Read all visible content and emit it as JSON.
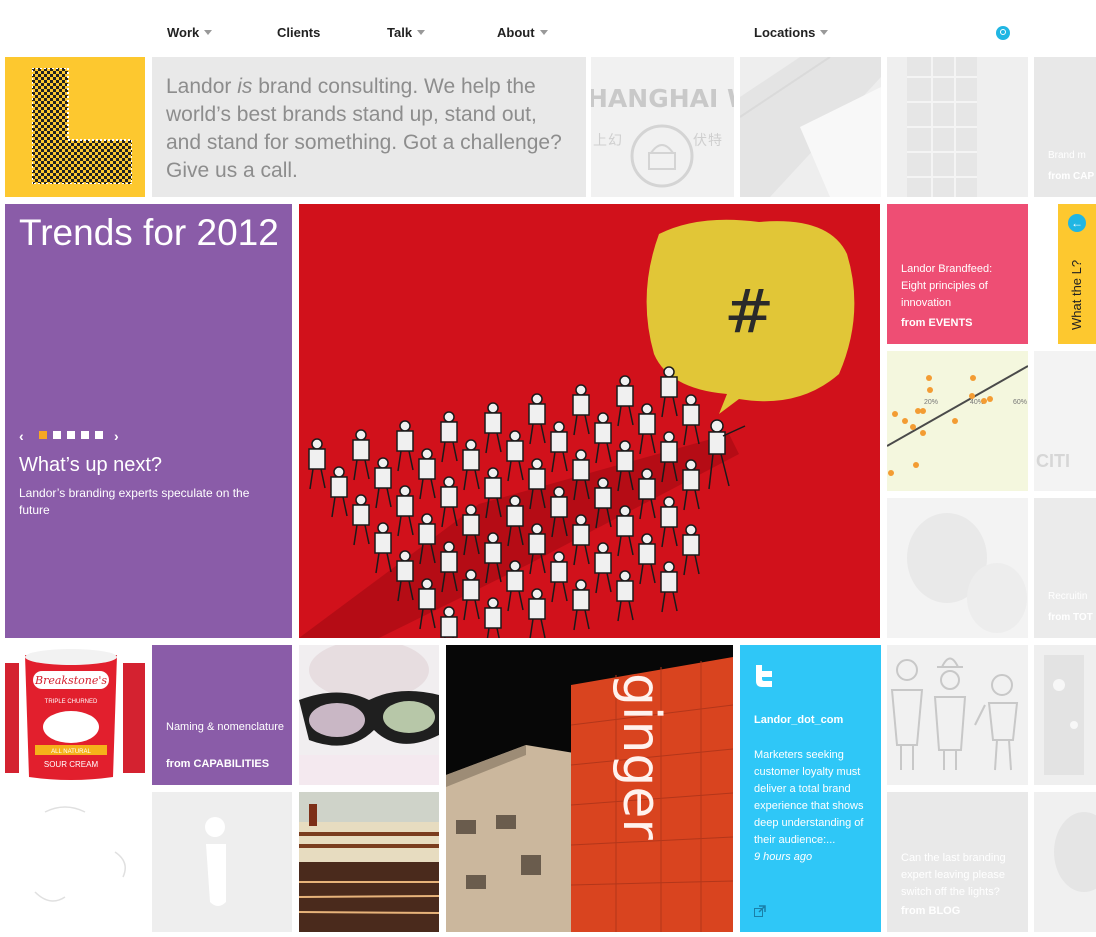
{
  "nav": {
    "items": [
      {
        "label": "Work",
        "has_menu": true
      },
      {
        "label": "Clients",
        "has_menu": false
      },
      {
        "label": "Talk",
        "has_menu": true
      },
      {
        "label": "About",
        "has_menu": true
      },
      {
        "label": "Locations",
        "has_menu": true
      }
    ],
    "search_icon": "search-icon"
  },
  "intro": {
    "text_before": "Landor ",
    "text_emph": "is",
    "text_after": " brand consulting. We help the world’s best brands stand up, stand out, and stand for something. Got a challenge? Give us a call."
  },
  "shanghai": {
    "word": "HANGHAI WHIT",
    "cn_left": "上幻",
    "cn_right": "伏特"
  },
  "far_top": {
    "text": "Brand m",
    "from": "from CAP"
  },
  "trends": {
    "title": "Trends for 2012",
    "heading": "What’s up next?",
    "description": "Landor’s branding experts speculate on the future",
    "pager_count": 6,
    "pager_active": 1
  },
  "hero": {
    "hashtag": "#"
  },
  "event": {
    "text": "Landor Brandfeed: Eight principles of innovation",
    "from": "from EVENTS"
  },
  "scatter": {
    "ticks": [
      "20%",
      "40%",
      "60%"
    ]
  },
  "what_the_l": {
    "label": "What the L?"
  },
  "citi": {
    "word": "CITI"
  },
  "recruit": {
    "text": "Recruitin",
    "from": "from TOT"
  },
  "naming": {
    "text": "Naming & nomenclature",
    "from": "from CAPABILITIES"
  },
  "sour_cream": {
    "brand": "Breakstone's",
    "sub": "TRIPLE CHURNED",
    "label": "ALL NATURAL",
    "product": "SOUR CREAM"
  },
  "ginger": {
    "sign": "ginger"
  },
  "twitter": {
    "handle": "Landor_dot_com",
    "body": "Marketers seeking customer loyalty must deliver a total brand experience that shows deep understanding of their audience:...",
    "time": "9 hours ago"
  },
  "blog": {
    "text": "Can the last branding expert leaving please switch off the lights?",
    "from": "from BLOG"
  },
  "colors": {
    "purple": "#8a5ca8",
    "pink": "#ee4e74",
    "yellow": "#fdc82f",
    "cyan": "#2fc7f7",
    "red": "#d8141d"
  }
}
